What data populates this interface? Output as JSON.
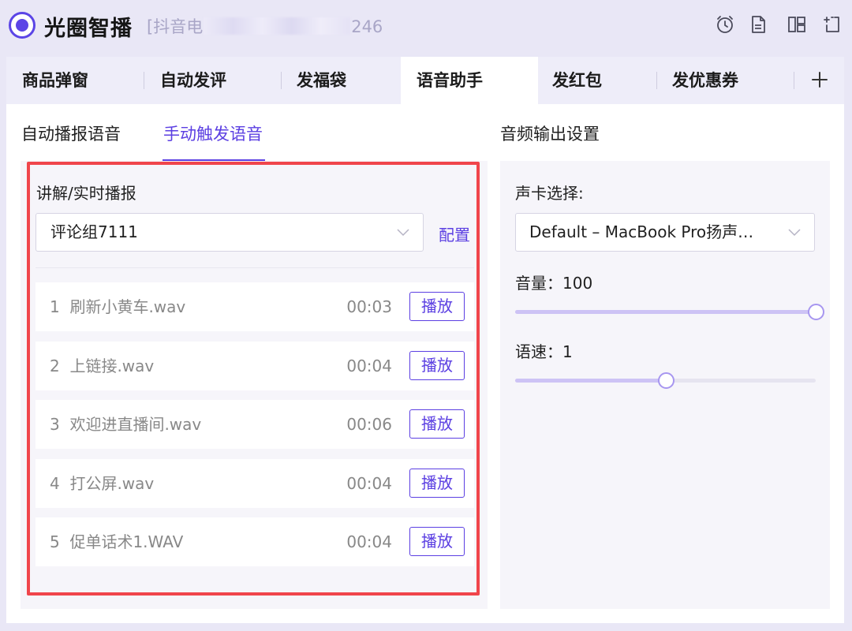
{
  "app": {
    "title": "光圈智播",
    "account_prefix": "[抖音电",
    "account_suffix": "246"
  },
  "toolbar_icons": [
    "alarm-clock-icon",
    "document-icon",
    "layout-icon",
    "export-icon"
  ],
  "tabs": [
    {
      "label": "商品弹窗",
      "active": false
    },
    {
      "label": "自动发评",
      "active": false
    },
    {
      "label": "发福袋",
      "active": false
    },
    {
      "label": "语音助手",
      "active": true
    },
    {
      "label": "发红包",
      "active": false
    },
    {
      "label": "发优惠券",
      "active": false
    }
  ],
  "subtabs": [
    {
      "label": "自动播报语音",
      "active": false
    },
    {
      "label": "手动触发语音",
      "active": true
    }
  ],
  "left": {
    "section_label": "讲解/实时播报",
    "group_select": "评论组7111",
    "config_link": "配置",
    "items": [
      {
        "index": "1",
        "name": "刷新小黄车.wav",
        "duration": "00:03",
        "button": "播放"
      },
      {
        "index": "2",
        "name": "上链接.wav",
        "duration": "00:04",
        "button": "播放"
      },
      {
        "index": "3",
        "name": "欢迎进直播间.wav",
        "duration": "00:06",
        "button": "播放"
      },
      {
        "index": "4",
        "name": "打公屏.wav",
        "duration": "00:04",
        "button": "播放"
      },
      {
        "index": "5",
        "name": "促单话术1.WAV",
        "duration": "00:04",
        "button": "播放"
      }
    ]
  },
  "audio": {
    "heading": "音频输出设置",
    "device_label": "声卡选择:",
    "device_value": "Default – MacBook Pro扬声…",
    "volume_label": "音量：100",
    "volume_level": 1.0,
    "speed_label": "语速：1",
    "speed_level": 0.5
  },
  "colors": {
    "accent": "#5b3fe2",
    "highlight_border": "#f0454b",
    "background": "#e9e7f6"
  }
}
